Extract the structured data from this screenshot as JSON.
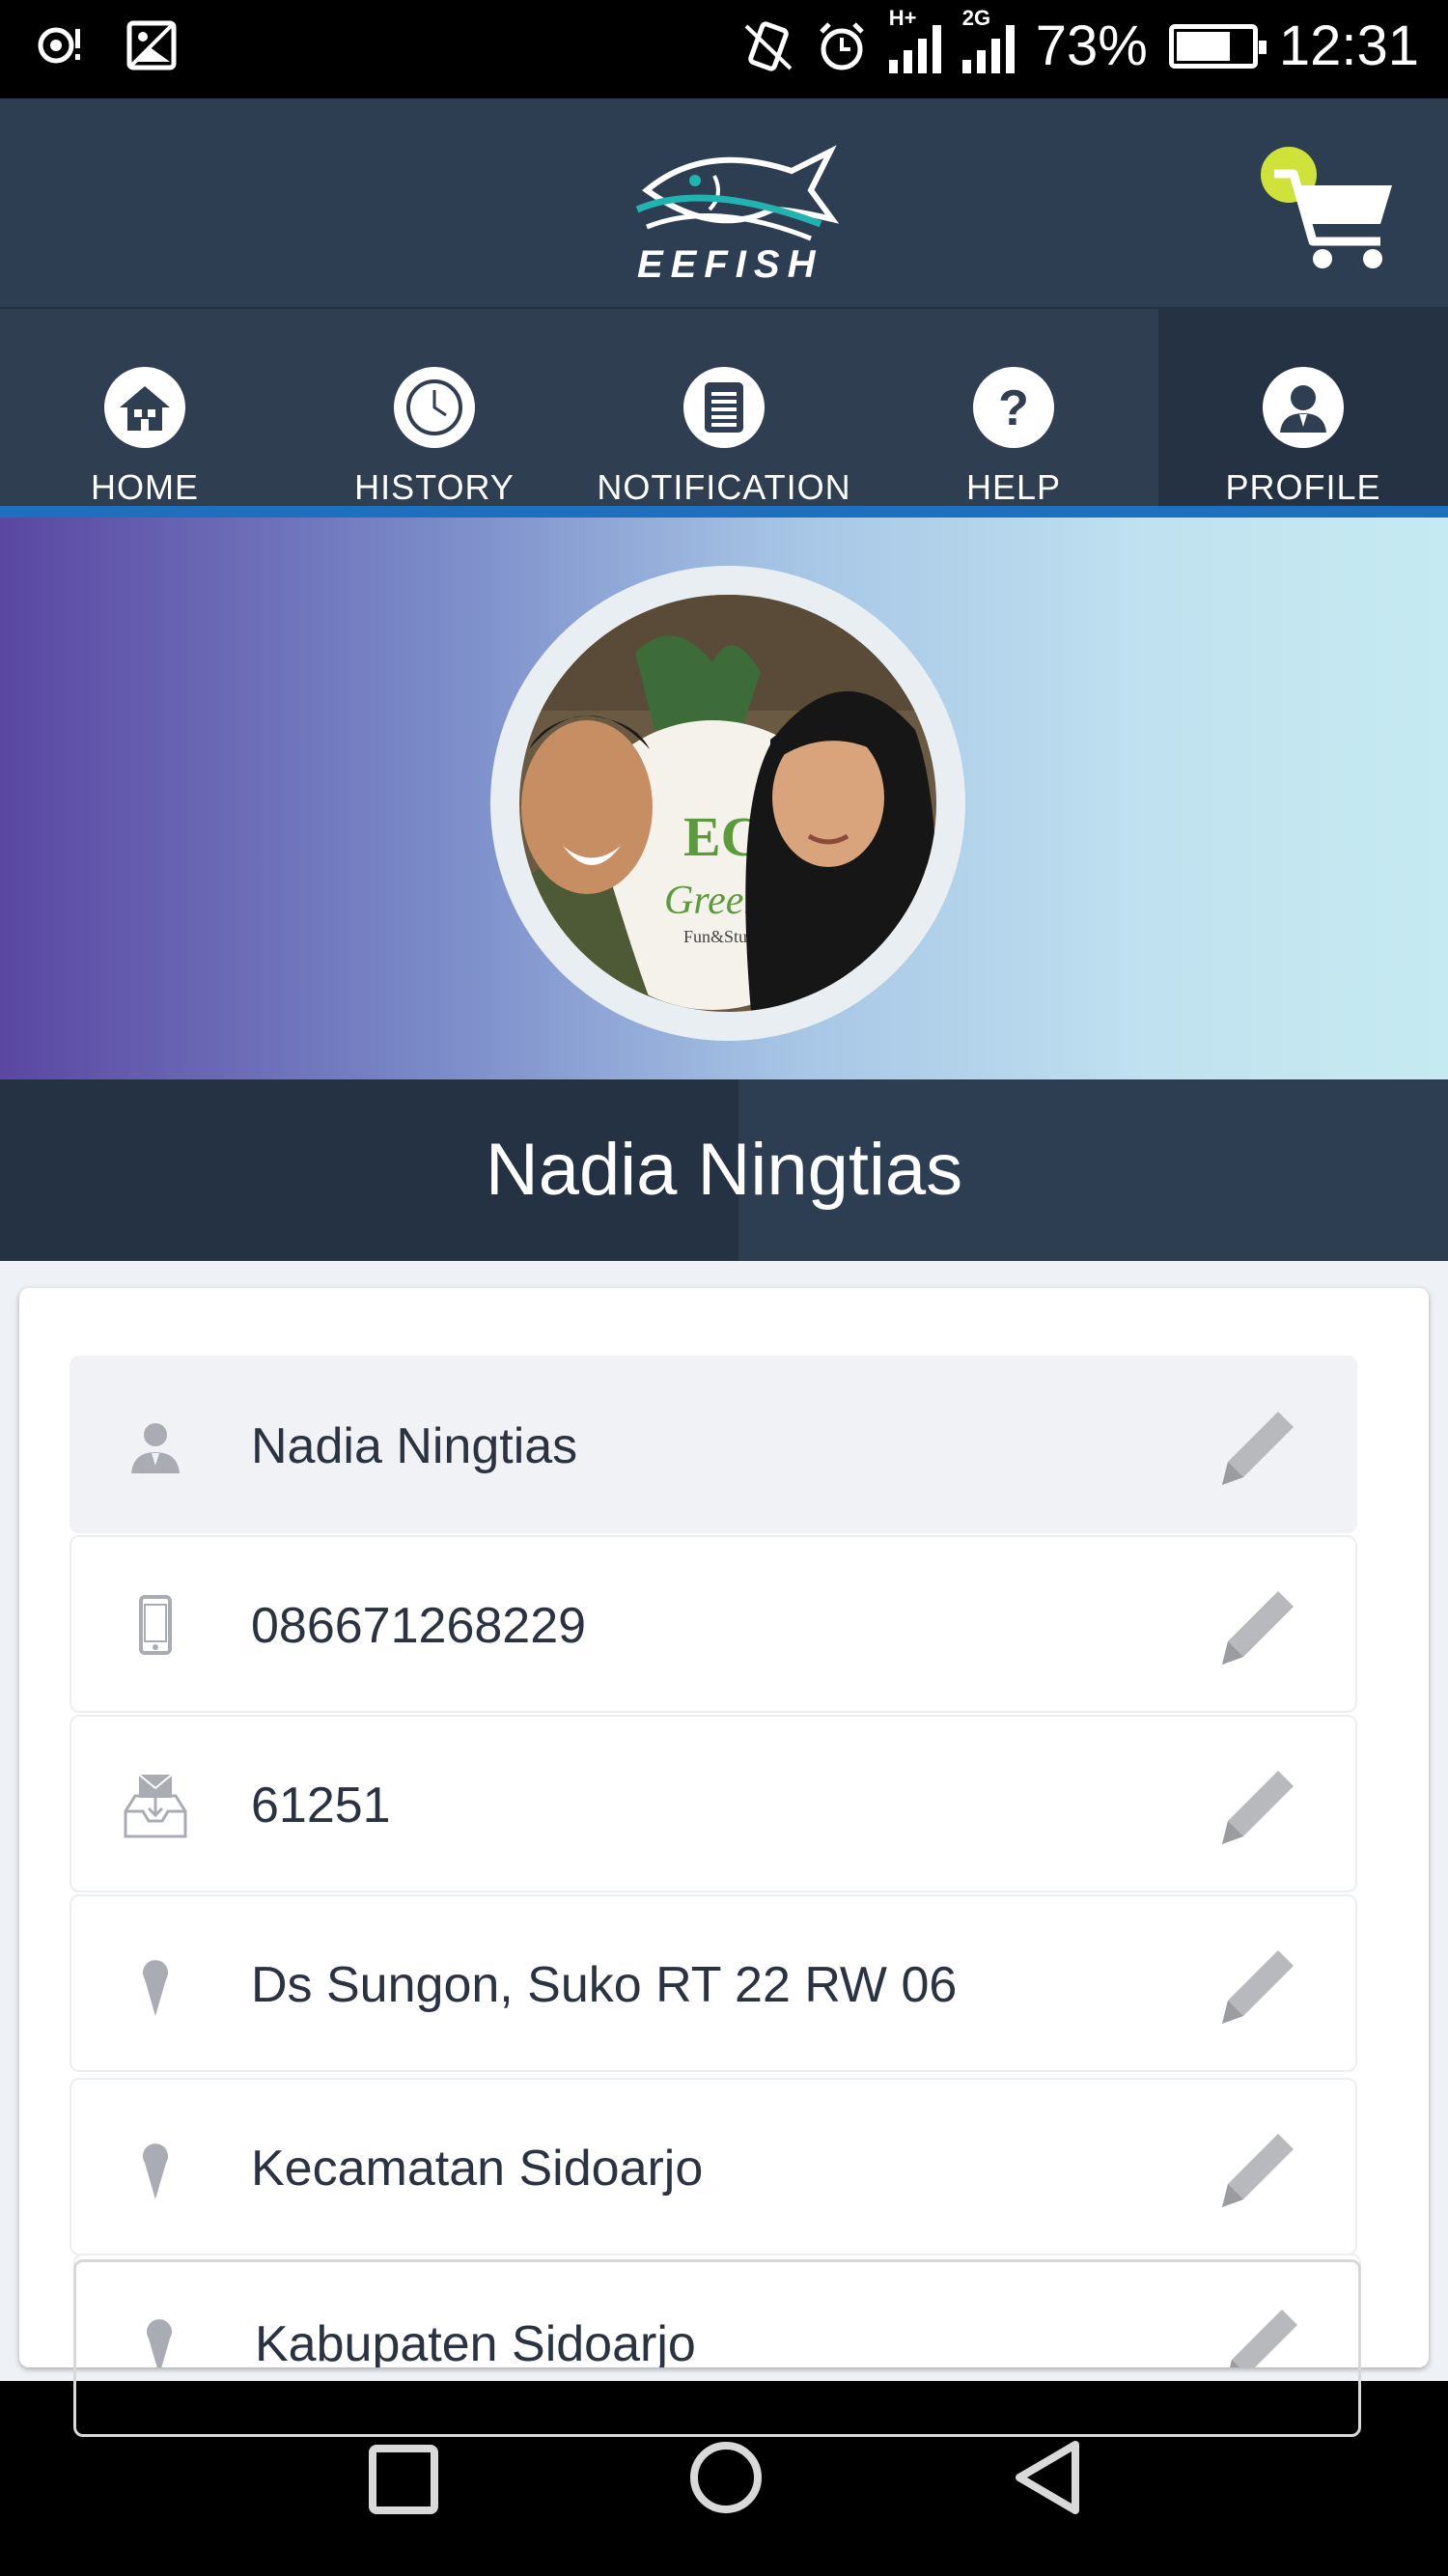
{
  "status_bar": {
    "network_1": "H+",
    "network_2": "2G",
    "battery_percent": "73%",
    "battery_level": 0.73,
    "time": "12:31"
  },
  "app": {
    "logo_text": "EEFISH",
    "cart_badge_color": "#cfe23a"
  },
  "nav": {
    "items": [
      {
        "label": "HOME",
        "icon": "home-icon"
      },
      {
        "label": "HISTORY",
        "icon": "clock-icon"
      },
      {
        "label": "NOTIFICATION",
        "icon": "list-icon"
      },
      {
        "label": "HELP",
        "icon": "question-icon"
      },
      {
        "label": "PROFILE",
        "icon": "user-icon"
      }
    ],
    "active": "PROFILE"
  },
  "profile": {
    "display_name": "Nadia Ningtias",
    "photo_sign_text": "ECO",
    "photo_sign_sub": "Green Pa",
    "photo_sign_small": "Fun&Study",
    "fields": [
      {
        "icon": "person-icon",
        "value": "Nadia Ningtias"
      },
      {
        "icon": "phone-icon",
        "value": "086671268229"
      },
      {
        "icon": "inbox-icon",
        "value": "61251"
      },
      {
        "icon": "location-pin-icon",
        "value": "Ds Sungon, Suko RT 22 RW 06"
      },
      {
        "icon": "location-pin-icon",
        "value": "Kecamatan Sidoarjo"
      },
      {
        "icon": "location-pin-icon",
        "value": "Kabupaten Sidoarjo"
      }
    ]
  },
  "colors": {
    "header": "#2e3e52",
    "nav_active": "#243244",
    "accent_underline": "#1f6fbf"
  }
}
